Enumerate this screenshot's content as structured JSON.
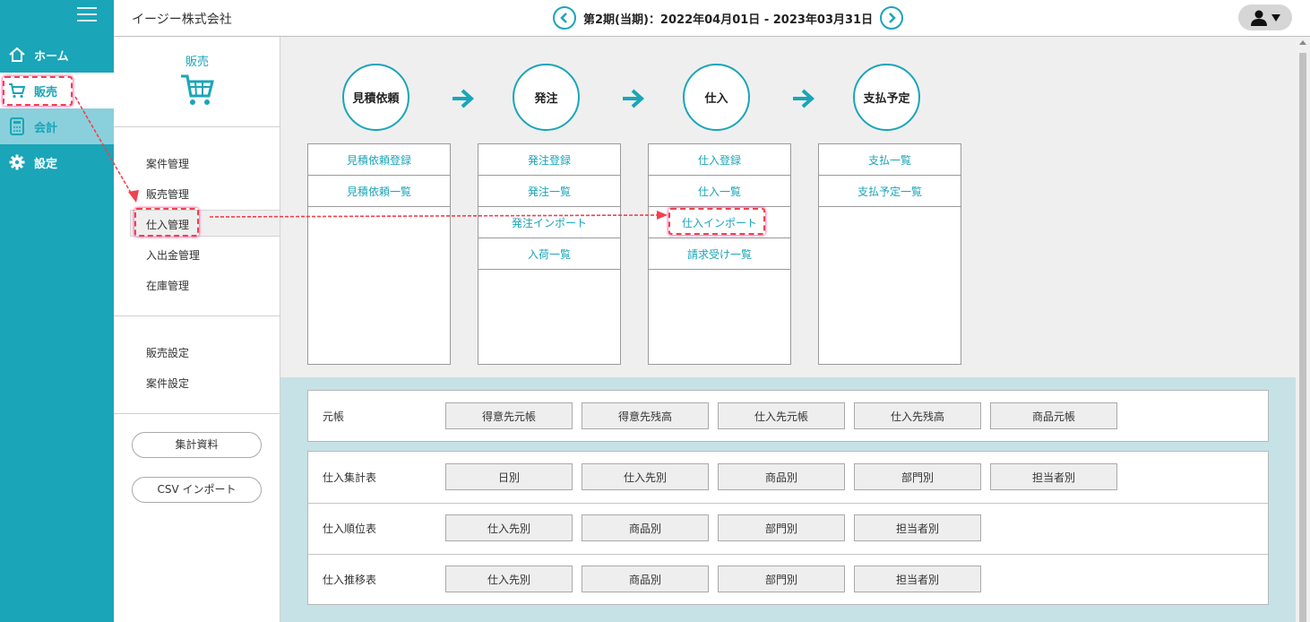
{
  "header": {
    "company": "イージー株式会社",
    "period": "第2期(当期)：2022年04月01日 - 2023年03月31日"
  },
  "nav": {
    "home": "ホーム",
    "sales": "販売",
    "accounting": "会計",
    "settings": "設定"
  },
  "sidebar": {
    "title": "販売",
    "items": [
      "案件管理",
      "販売管理",
      "仕入管理",
      "入出金管理",
      "在庫管理"
    ],
    "settings_items": [
      "販売設定",
      "案件設定"
    ],
    "buttons": [
      "集計資料",
      "CSV インポート"
    ]
  },
  "flow": {
    "steps": [
      "見積依頼",
      "発注",
      "仕入",
      "支払予定"
    ],
    "boxes": [
      [
        "見積依頼登録",
        "見積依頼一覧"
      ],
      [
        "発注登録",
        "発注一覧",
        "発注インポート",
        "入荷一覧"
      ],
      [
        "仕入登録",
        "仕入一覧",
        "仕入インポート",
        "請求受け一覧"
      ],
      [
        "支払一覧",
        "支払予定一覧"
      ]
    ]
  },
  "ledger": {
    "label": "元帳",
    "buttons": [
      "得意先元帳",
      "得意先残高",
      "仕入先元帳",
      "仕入先残高",
      "商品元帳"
    ]
  },
  "reports": [
    {
      "label": "仕入集計表",
      "buttons": [
        "日別",
        "仕入先別",
        "商品別",
        "部門別",
        "担当者別"
      ]
    },
    {
      "label": "仕入順位表",
      "buttons": [
        "仕入先別",
        "商品別",
        "部門別",
        "担当者別"
      ]
    },
    {
      "label": "仕入推移表",
      "buttons": [
        "仕入先別",
        "商品別",
        "部門別",
        "担当者別"
      ]
    }
  ],
  "colors": {
    "accent": "#1aa5b8",
    "annotation": "#f0414e"
  }
}
